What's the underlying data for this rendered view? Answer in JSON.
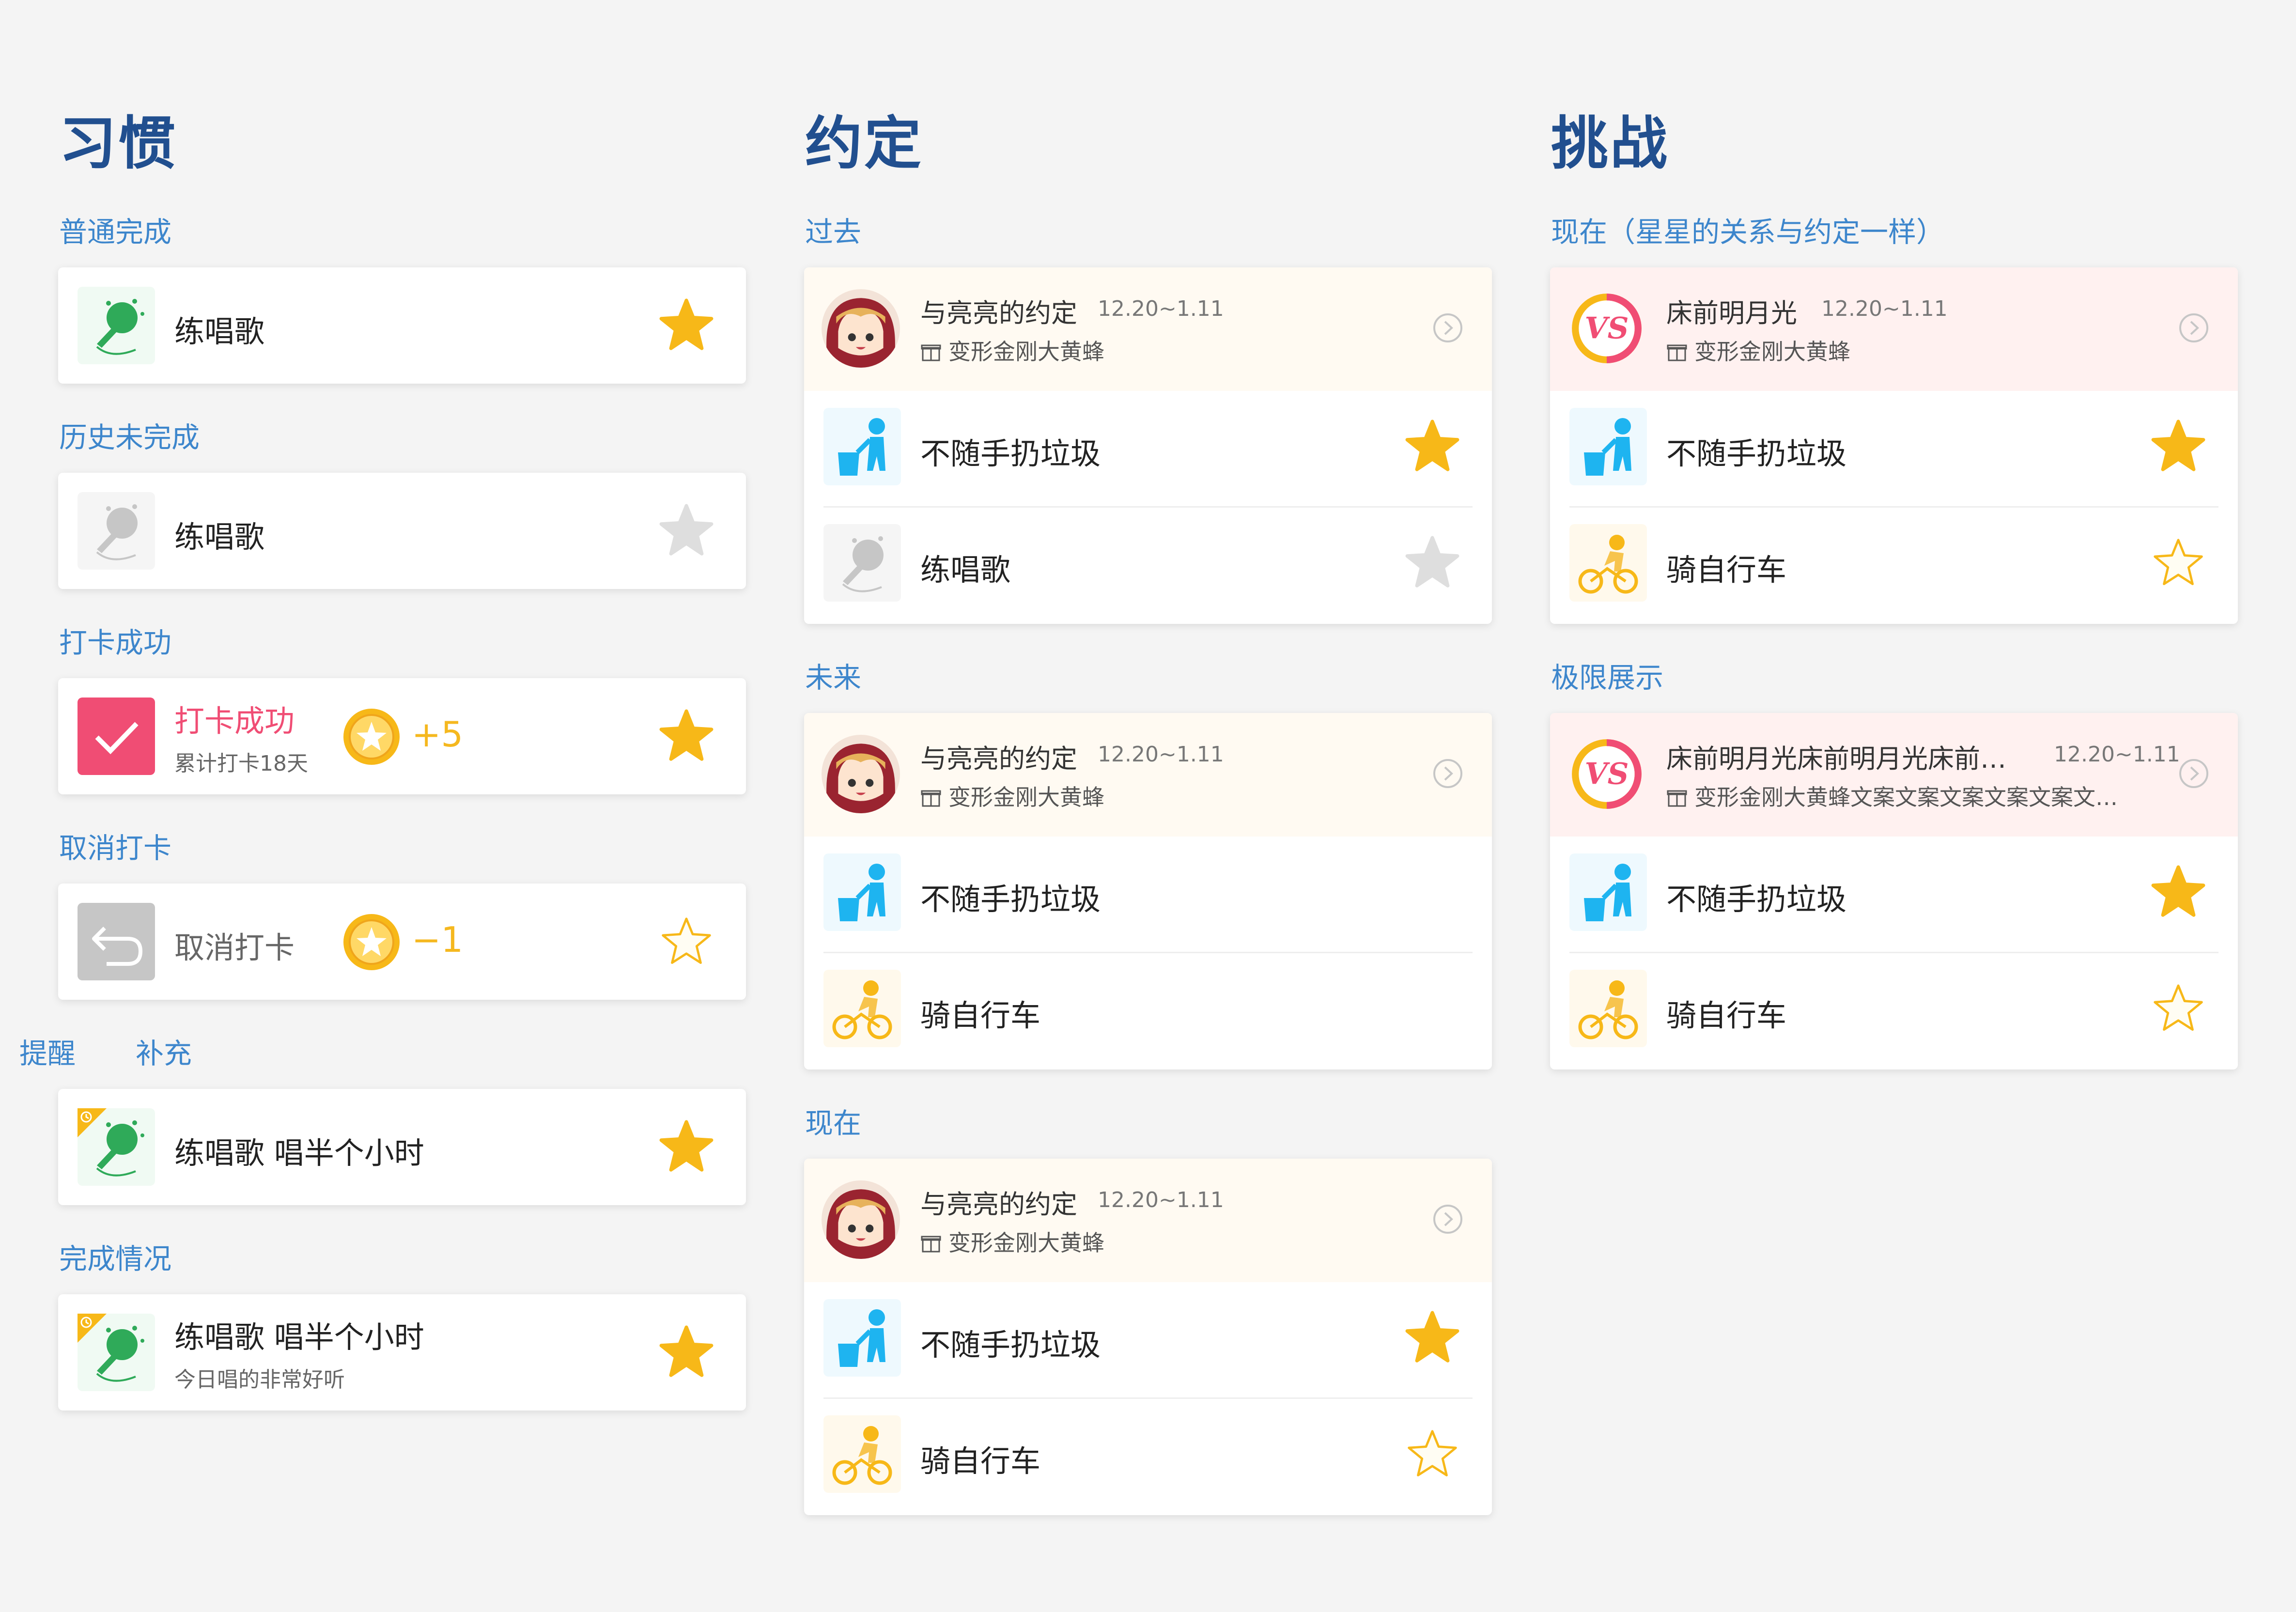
{
  "habits": {
    "title": "习惯",
    "normal": {
      "label": "普通完成",
      "task": "练唱歌"
    },
    "history": {
      "label": "历史未完成",
      "task": "练唱歌"
    },
    "checked": {
      "label": "打卡成功",
      "title": "打卡成功",
      "subtitle": "累计打卡18天",
      "points": "+5"
    },
    "cancel": {
      "label": "取消打卡",
      "title": "取消打卡",
      "points": "−1"
    },
    "remind": {
      "label": "提醒",
      "label2": "补充",
      "task": "练唱歌 唱半个小时"
    },
    "status": {
      "label": "完成情况",
      "task": "练唱歌 唱半个小时",
      "subtitle": "今日唱的非常好听"
    }
  },
  "promises": {
    "title": "约定",
    "past": {
      "label": "过去",
      "title": "与亮亮的约定",
      "date": "12.20~1.11",
      "reward": "变形金刚大黄蜂",
      "rows": [
        "不随手扔垃圾",
        "练唱歌"
      ]
    },
    "future": {
      "label": "未来",
      "title": "与亮亮的约定",
      "date": "12.20~1.11",
      "reward": "变形金刚大黄蜂",
      "rows": [
        "不随手扔垃圾",
        "骑自行车"
      ]
    },
    "now": {
      "label": "现在",
      "title": "与亮亮的约定",
      "date": "12.20~1.11",
      "reward": "变形金刚大黄蜂",
      "rows": [
        "不随手扔垃圾",
        "骑自行车"
      ]
    }
  },
  "challenges": {
    "title": "挑战",
    "now": {
      "label": "现在（星星的关系与约定一样）",
      "title": "床前明月光",
      "date": "12.20~1.11",
      "reward": "变形金刚大黄蜂",
      "rows": [
        "不随手扔垃圾",
        "骑自行车"
      ]
    },
    "limit": {
      "label": "极限展示",
      "title": "床前明月光床前明月光床前…",
      "date": "12.20~1.11",
      "reward": "变形金刚大黄蜂文案文案文案文案文案文…",
      "rows": [
        "不随手扔垃圾",
        "骑自行车"
      ]
    }
  },
  "colors": {
    "accent": "#3d86cc",
    "title": "#214f8f",
    "star": "#f5b81f",
    "checkin": "#f04d74",
    "promiseHeader": "#fffaf2",
    "challengeHeader": "#fff1f0"
  }
}
